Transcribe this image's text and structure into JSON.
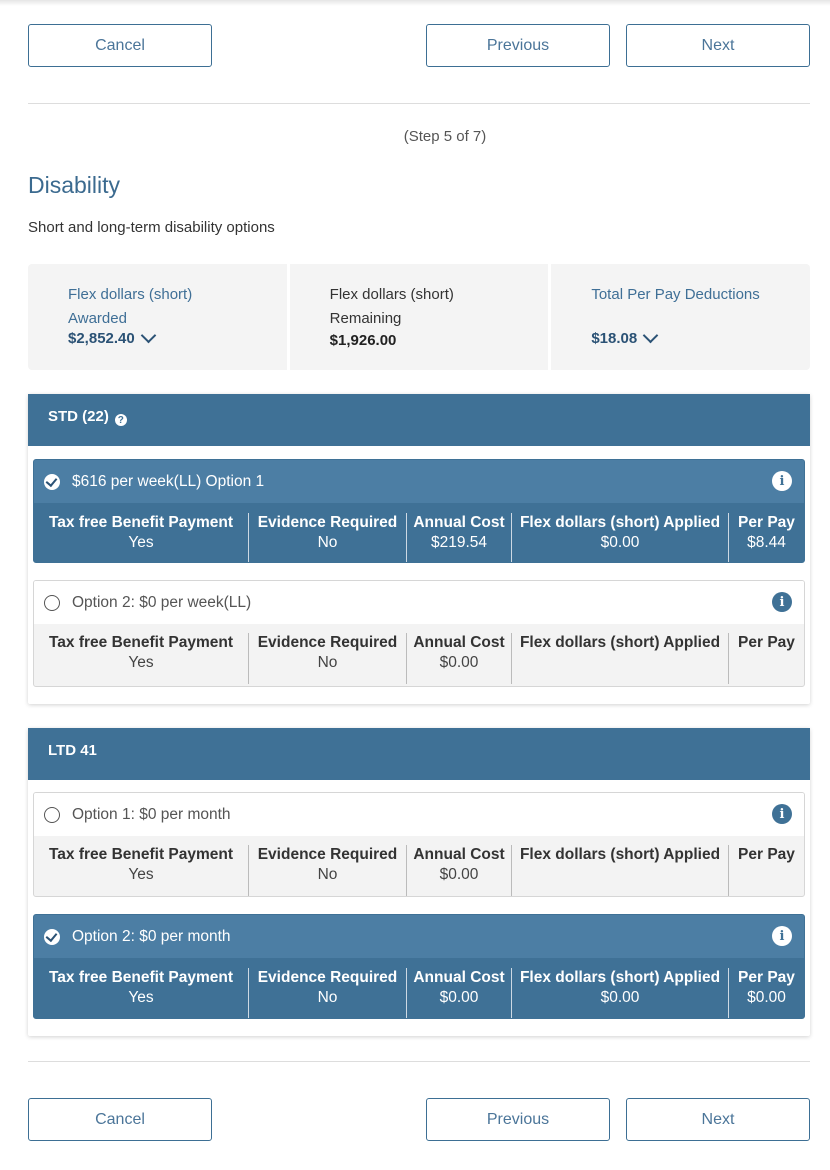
{
  "nav": {
    "cancel": "Cancel",
    "previous": "Previous",
    "next": "Next"
  },
  "step": "(Step 5 of 7)",
  "page": {
    "title": "Disability",
    "subtitle": "Short and long-term disability options"
  },
  "summary": {
    "awarded_label_1": "Flex dollars (short)",
    "awarded_label_2": "Awarded",
    "awarded_value": "$2,852.40",
    "remaining_label_1": "Flex dollars (short)",
    "remaining_label_2": "Remaining",
    "remaining_value": "$1,926.00",
    "deductions_label": "Total Per Pay Deductions",
    "deductions_value": "$18.08"
  },
  "columns": [
    "Tax free Benefit Payment",
    "Evidence Required",
    "Annual Cost",
    "Flex dollars (short) Applied",
    "Per Pay"
  ],
  "std": {
    "title": "STD (22)",
    "options": [
      {
        "label": "$616 per week(LL) Option 1",
        "selected": true,
        "values": [
          "Yes",
          "No",
          "$219.54",
          "$0.00",
          "$8.44"
        ]
      },
      {
        "label": "Option 2: $0 per week(LL)",
        "selected": false,
        "values": [
          "Yes",
          "No",
          "$0.00",
          "",
          ""
        ]
      }
    ]
  },
  "ltd": {
    "title": "LTD 41",
    "options": [
      {
        "label": "Option 1: $0 per month",
        "selected": false,
        "values": [
          "Yes",
          "No",
          "$0.00",
          "",
          ""
        ]
      },
      {
        "label": "Option 2: $0 per month",
        "selected": true,
        "values": [
          "Yes",
          "No",
          "$0.00",
          "$0.00",
          "$0.00"
        ]
      }
    ]
  },
  "colors": {
    "primary": "#3f7196",
    "header_selected": "#4c7ea4",
    "link": "#2b5275",
    "title": "#3b6a8f"
  }
}
